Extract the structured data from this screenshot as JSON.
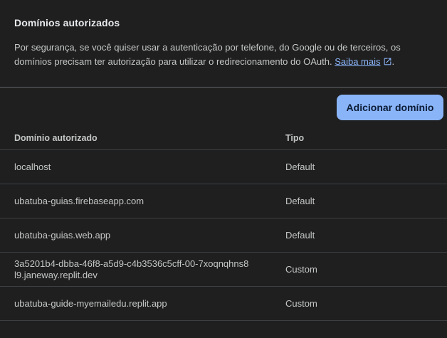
{
  "section": {
    "title": "Domínios autorizados",
    "description": "Por segurança, se você quiser usar a autenticação por telefone, do Google ou de terceiros, os domínios precisam ter autorização para utilizar o redirecionamento do OAuth.",
    "link_label": "Saiba mais",
    "trailing_punct": "."
  },
  "actions": {
    "add_domain_label": "Adicionar domínio"
  },
  "table": {
    "columns": {
      "domain": "Domínio autorizado",
      "type": "Tipo"
    },
    "rows": [
      {
        "domain": "localhost",
        "type": "Default"
      },
      {
        "domain": "ubatuba-guias.firebaseapp.com",
        "type": "Default"
      },
      {
        "domain": "ubatuba-guias.web.app",
        "type": "Default"
      },
      {
        "domain": "3a5201b4-dbba-46f8-a5d9-c4b3536c5cff-00-7xoqnqhns8l9.janeway.replit.dev",
        "type": "Custom"
      },
      {
        "domain": "ubatuba-guide-myemailedu.replit.app",
        "type": "Custom"
      }
    ]
  },
  "colors": {
    "background": "#1f1f1f",
    "accent": "#8ab4f8",
    "divider": "#5f6368"
  },
  "icons": {
    "link": "open-in-new-icon"
  }
}
